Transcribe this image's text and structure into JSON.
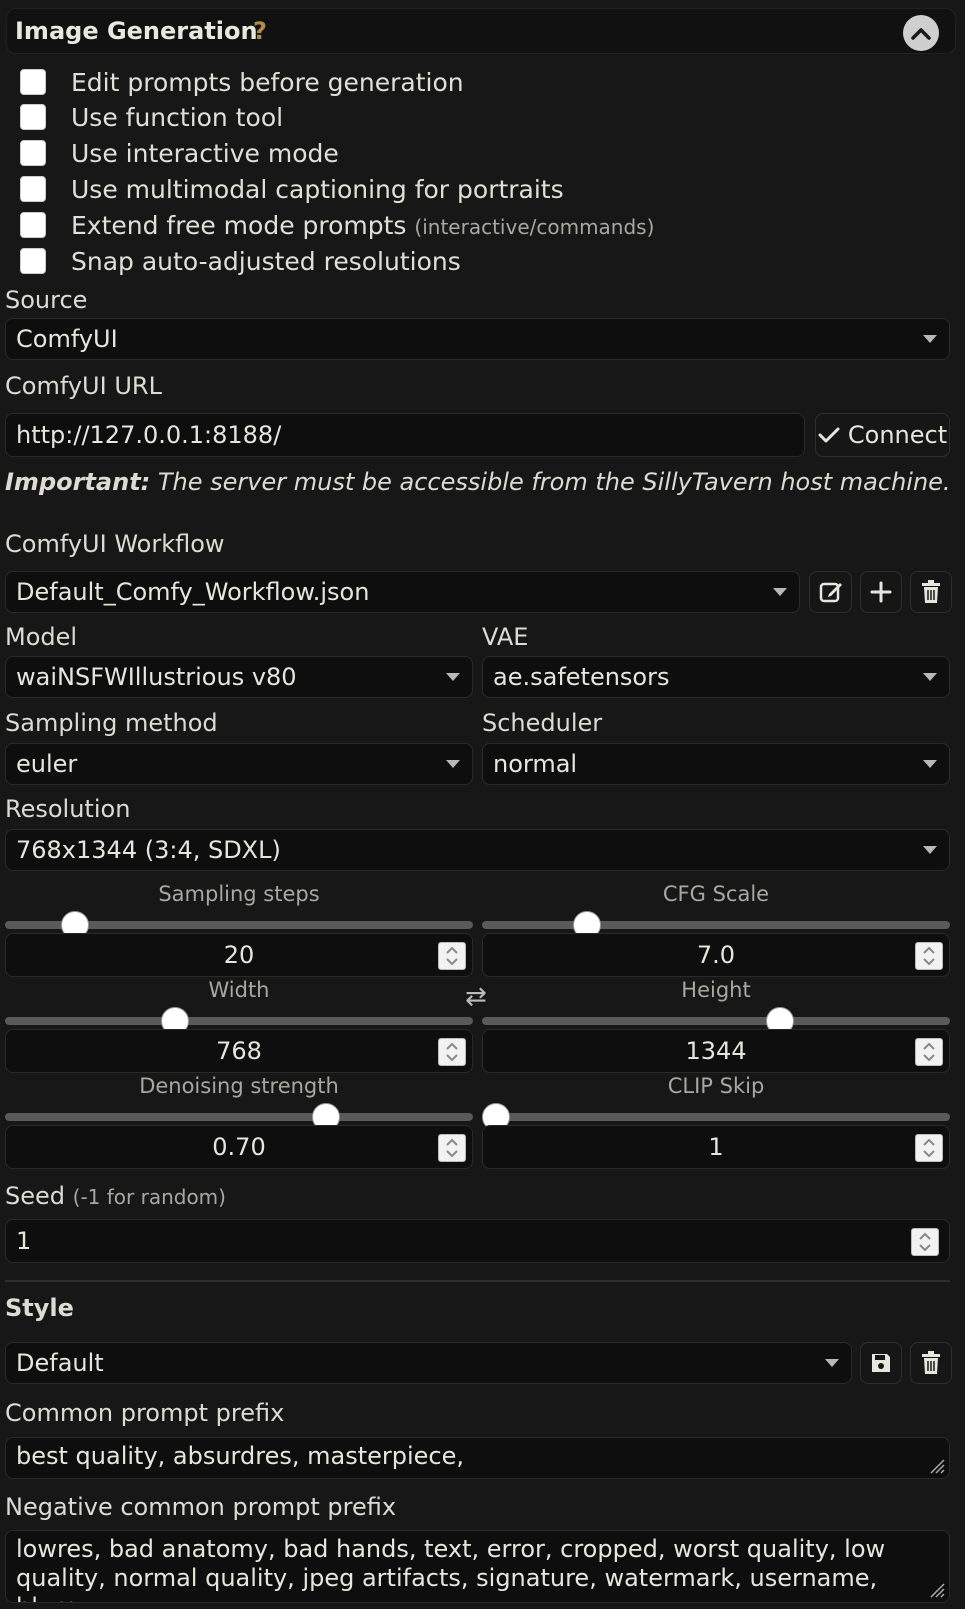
{
  "header": {
    "title": "Image Generation",
    "help": "?"
  },
  "checkboxes": [
    {
      "label": "Edit prompts before generation",
      "hint": ""
    },
    {
      "label": "Use function tool",
      "hint": ""
    },
    {
      "label": "Use interactive mode",
      "hint": ""
    },
    {
      "label": "Use multimodal captioning for portraits",
      "hint": ""
    },
    {
      "label": "Extend free mode prompts",
      "hint": "(interactive/commands)"
    },
    {
      "label": "Snap auto-adjusted resolutions",
      "hint": ""
    }
  ],
  "source": {
    "label": "Source",
    "value": "ComfyUI"
  },
  "url": {
    "label": "ComfyUI URL",
    "value": "http://127.0.0.1:8188/",
    "connect_label": "Connect"
  },
  "note": {
    "strong": "Important:",
    "text": " The server must be accessible from the SillyTavern host machine."
  },
  "workflow": {
    "label": "ComfyUI Workflow",
    "value": "Default_Comfy_Workflow.json"
  },
  "model": {
    "label": "Model",
    "value": "waiNSFWIllustrious v80"
  },
  "vae": {
    "label": "VAE",
    "value": "ae.safetensors"
  },
  "sampler": {
    "label": "Sampling method",
    "value": "euler"
  },
  "scheduler": {
    "label": "Scheduler",
    "value": "normal"
  },
  "resolution": {
    "label": "Resolution",
    "value": "768x1344 (3:4, SDXL)"
  },
  "sliders": {
    "steps": {
      "label": "Sampling steps",
      "value": "20"
    },
    "cfg": {
      "label": "CFG Scale",
      "value": "7.0"
    },
    "width": {
      "label": "Width",
      "value": "768"
    },
    "height": {
      "label": "Height",
      "value": "1344"
    },
    "denoise": {
      "label": "Denoising strength",
      "value": "0.70"
    },
    "clip": {
      "label": "CLIP Skip",
      "value": "1"
    }
  },
  "seed": {
    "label": "Seed",
    "hint": "(-1 for random)",
    "value": "1"
  },
  "style": {
    "heading": "Style",
    "value": "Default",
    "prefix_label": "Common prompt prefix",
    "prefix_value": "best quality, absurdres, masterpiece,",
    "negative_label": "Negative common prompt prefix",
    "negative_value": "lowres, bad anatomy, bad hands, text, error, cropped, worst quality, low quality, normal quality, jpeg artifacts, signature, watermark, username, blurry"
  }
}
